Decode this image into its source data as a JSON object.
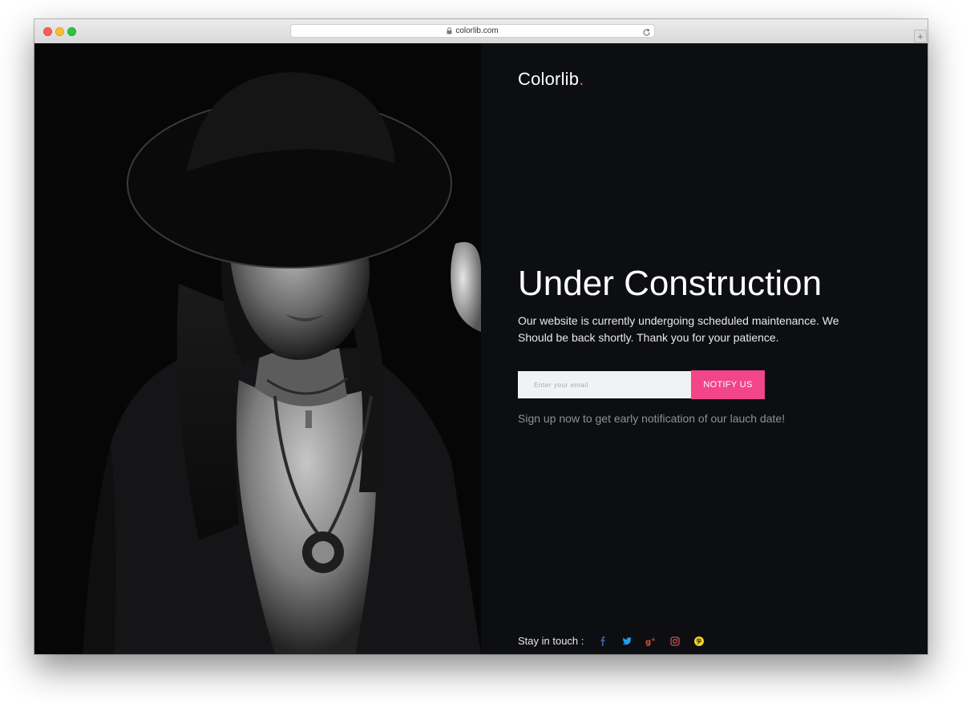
{
  "browser": {
    "url": "colorlib.com"
  },
  "brand": {
    "name": "Colorlib",
    "dot": ".",
    "accent_color": "#f2458a"
  },
  "hero": {
    "title": "Under Construction",
    "subtitle": "Our website is currently undergoing scheduled maintenance. We Should be back shortly. Thank you for your patience."
  },
  "form": {
    "email_placeholder": "Enter your email",
    "email_value": "",
    "notify_label": "NOTIFY US",
    "note": "Sign up now to get early notification of our lauch date!"
  },
  "social": {
    "label": "Stay in touch :",
    "icons": [
      {
        "name": "facebook-icon",
        "color": "#3b5998"
      },
      {
        "name": "twitter-icon",
        "color": "#1da1f2"
      },
      {
        "name": "google-plus-icon",
        "color": "#dd4b39"
      },
      {
        "name": "instagram-icon",
        "color": "#c0524b"
      },
      {
        "name": "pinterest-icon",
        "color": "#f5d423"
      }
    ]
  }
}
